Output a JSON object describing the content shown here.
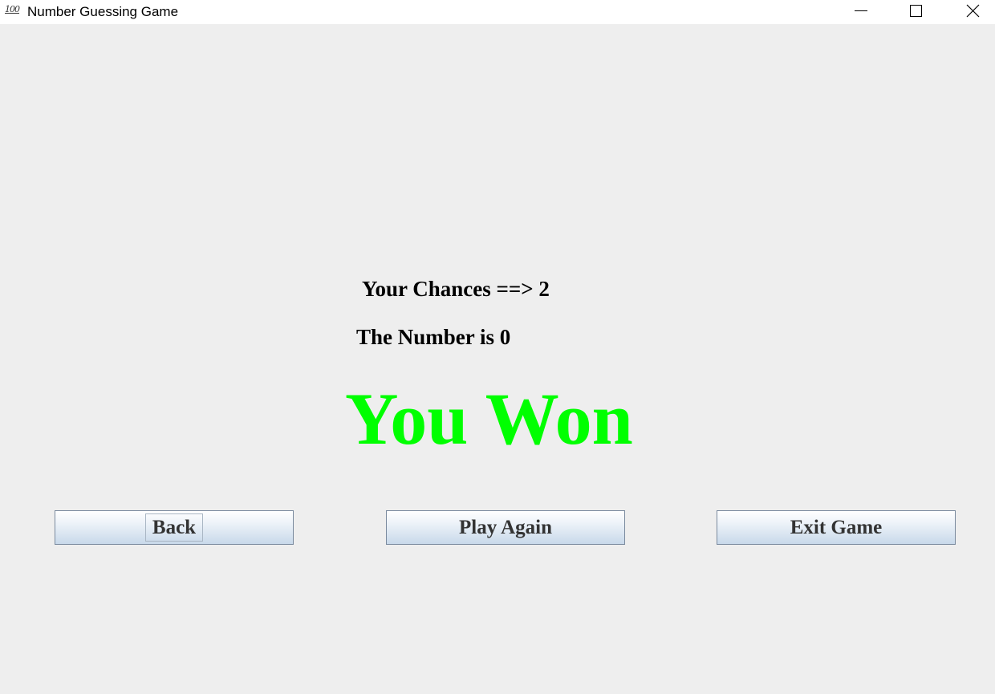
{
  "window": {
    "title": "Number Guessing Game",
    "icon_text": "100",
    "icon": "hundred-points-icon",
    "controls": [
      "minimize-icon",
      "maximize-icon",
      "close-icon"
    ]
  },
  "game": {
    "chances_text": "Your Chances ==> 2",
    "number_text": "The Number is 0",
    "result_text": "You Won",
    "result_color": "#00ff00"
  },
  "buttons": {
    "back_label": "Back",
    "play_again_label": "Play Again",
    "exit_label": "Exit Game"
  }
}
